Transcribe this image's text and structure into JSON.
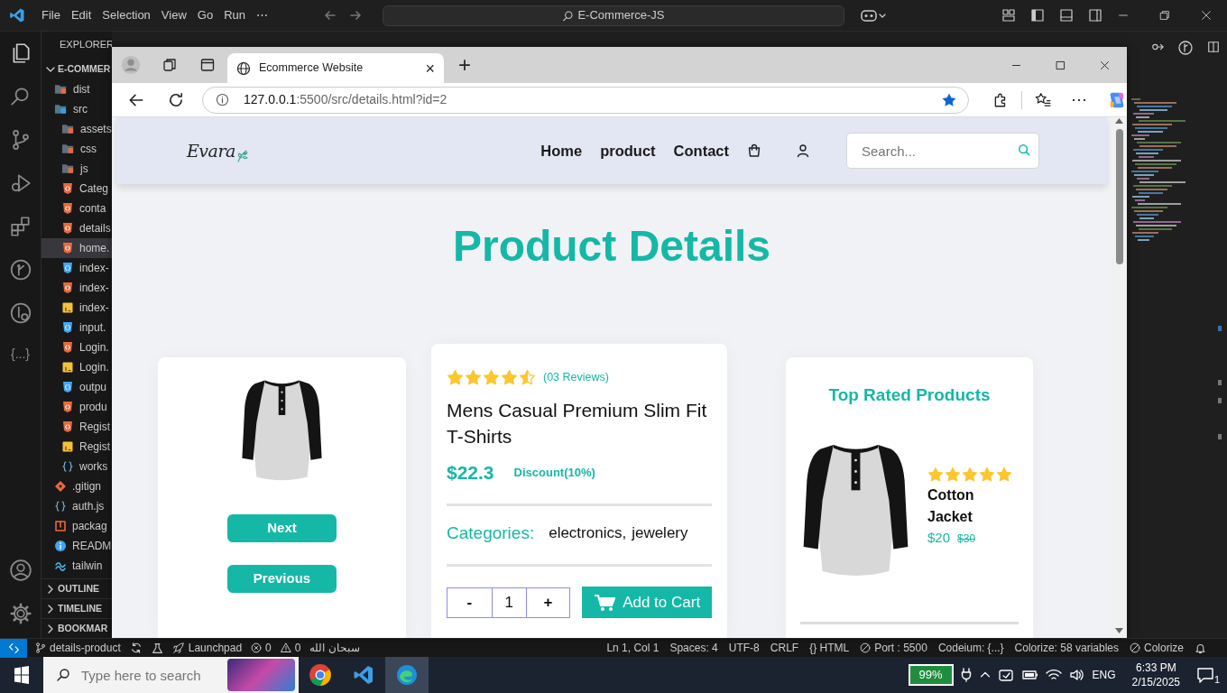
{
  "vscode": {
    "menu": [
      "File",
      "Edit",
      "Selection",
      "View",
      "Go",
      "Run",
      "⋯"
    ],
    "command_center": "E-Commerce-JS",
    "activity_bar": {
      "snippets_label": "{...}"
    },
    "explorer": {
      "title": "EXPLORER",
      "section": "E-COMMER",
      "expanded": true,
      "items": [
        {
          "name": "dist",
          "kind": "folder",
          "expanded": false,
          "selected": false
        },
        {
          "name": "src",
          "kind": "folder",
          "expanded": true,
          "selected": false,
          "children": [
            {
              "name": "assets",
              "kind": "folder",
              "expanded": false,
              "selected": false
            },
            {
              "name": "css",
              "kind": "folder",
              "expanded": false,
              "selected": false
            },
            {
              "name": "js",
              "kind": "folder",
              "expanded": false,
              "selected": false
            },
            {
              "name": "Categ",
              "kind": "html",
              "selected": false
            },
            {
              "name": "conta",
              "kind": "html",
              "selected": false
            },
            {
              "name": "details",
              "kind": "html",
              "selected": false
            },
            {
              "name": "home.",
              "kind": "html",
              "selected": true
            },
            {
              "name": "index-",
              "kind": "css",
              "selected": false
            },
            {
              "name": "index-",
              "kind": "html",
              "selected": false
            },
            {
              "name": "index-",
              "kind": "js",
              "selected": false
            },
            {
              "name": "input.",
              "kind": "css",
              "selected": false
            },
            {
              "name": "Login.",
              "kind": "html",
              "selected": false
            },
            {
              "name": "Login.",
              "kind": "js",
              "selected": false
            },
            {
              "name": "outpu",
              "kind": "css",
              "selected": false
            },
            {
              "name": "produ",
              "kind": "html",
              "selected": false
            },
            {
              "name": "Regist",
              "kind": "html",
              "selected": false
            },
            {
              "name": "Regist",
              "kind": "js",
              "selected": false
            },
            {
              "name": "works",
              "kind": "json",
              "selected": false
            }
          ]
        },
        {
          "name": ".gitign",
          "kind": "git",
          "selected": false
        },
        {
          "name": "auth.js",
          "kind": "json",
          "selected": false
        },
        {
          "name": "packag",
          "kind": "package",
          "selected": false
        },
        {
          "name": "READM",
          "kind": "info",
          "selected": false
        },
        {
          "name": "tailwin",
          "kind": "tailwind",
          "selected": false
        }
      ]
    },
    "panels": [
      {
        "title": "OUTLINE",
        "expanded": false
      },
      {
        "title": "TIMELINE",
        "expanded": false
      },
      {
        "title": "BOOKMAR",
        "expanded": false
      }
    ],
    "status_bar": {
      "left": [
        {
          "kind": "branch",
          "text": "details-product"
        },
        {
          "kind": "sync"
        },
        {
          "kind": "flask"
        },
        {
          "kind": "rocket",
          "text": "Launchpad"
        },
        {
          "kind": "error",
          "text": "0"
        },
        {
          "kind": "warning",
          "text": "0"
        },
        {
          "kind": "plain",
          "text": "سبحان الله"
        }
      ],
      "right": [
        {
          "kind": "plain",
          "text": "Ln 1, Col 1"
        },
        {
          "kind": "plain",
          "text": "Spaces: 4"
        },
        {
          "kind": "plain",
          "text": "UTF-8"
        },
        {
          "kind": "plain",
          "text": "CRLF"
        },
        {
          "kind": "plain",
          "text": "{} HTML"
        },
        {
          "kind": "blocked",
          "text": "Port : 5500"
        },
        {
          "kind": "plain",
          "text": "Codeium: {...}"
        },
        {
          "kind": "plain",
          "text": "Colorize: 58 variables"
        },
        {
          "kind": "blocked",
          "text": "Colorize"
        },
        {
          "kind": "bell"
        }
      ]
    }
  },
  "browser": {
    "tab": {
      "title": "Ecommerce Website",
      "close": "×"
    },
    "new_tab": "+",
    "url_host": "127.0.0.1",
    "url_rest": ":5500/src/details.html?id=2",
    "favorited": true,
    "more": "⋯",
    "page": {
      "logo": "Evara",
      "nav_links": [
        "Home",
        "product",
        "Contact"
      ],
      "search": {
        "placeholder": "Search..."
      },
      "heading": "Product Details",
      "gallery": {
        "buttons": [
          "Next",
          "Previous"
        ]
      },
      "product": {
        "stars": 4.5,
        "reviews": "(03 Reviews)",
        "title": "Mens Casual Premium Slim Fit T-Shirts",
        "price": "$22.3",
        "discount": "Discount(10%)",
        "categories_label": "Categories:",
        "categories": [
          "electronics,",
          "jewelery"
        ],
        "quantity": {
          "minus": "-",
          "value": "1",
          "plus": "+"
        },
        "add_to_cart": "Add to Cart"
      },
      "top_rated": {
        "title": "Top Rated Products",
        "items": [
          {
            "stars": 5,
            "name": "Cotton Jacket",
            "price": "$20",
            "old_price": "$30"
          }
        ]
      }
    }
  },
  "taskbar": {
    "search_placeholder": "Type here to search",
    "apps": [
      {
        "kind": "chrome",
        "selected": false
      },
      {
        "kind": "vscode",
        "selected": false
      },
      {
        "kind": "edge",
        "selected": true
      }
    ],
    "battery": "99%",
    "language": "ENG",
    "time": "6:33 PM",
    "date": "2/15/2025",
    "notifications": "1"
  }
}
